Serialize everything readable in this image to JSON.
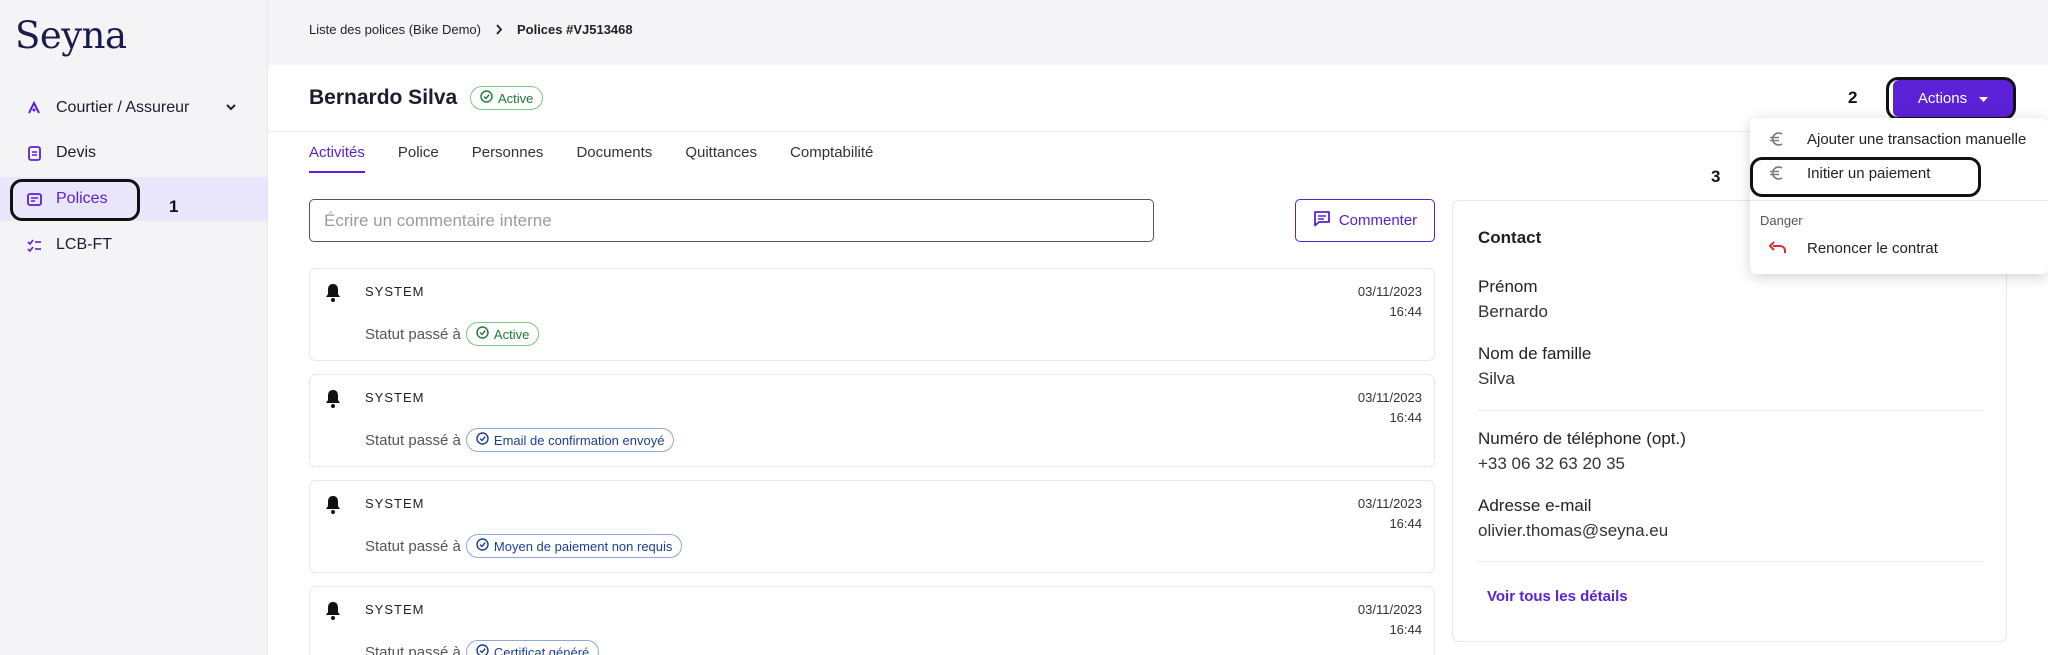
{
  "sidebar": {
    "logo": "Seyna",
    "items": [
      {
        "label": "Courtier / Assureur"
      },
      {
        "label": "Devis"
      },
      {
        "label": "Polices"
      },
      {
        "label": "LCB-FT"
      }
    ]
  },
  "breadcrumb": {
    "parent": "Liste des polices (Bike Demo)",
    "current": "Polices #VJ513468"
  },
  "header": {
    "title": "Bernardo Silva",
    "status": "Active",
    "actions_label": "Actions"
  },
  "tabs": [
    "Activités",
    "Police",
    "Personnes",
    "Documents",
    "Quittances",
    "Comptabilité"
  ],
  "comment": {
    "placeholder": "Écrire un commentaire interne",
    "button_label": "Commenter"
  },
  "activities": [
    {
      "author": "SYSTEM",
      "date": "03/11/2023",
      "time": "16:44",
      "prefix": "Statut passé à",
      "status": "Active"
    },
    {
      "author": "SYSTEM",
      "date": "03/11/2023",
      "time": "16:44",
      "prefix": "Statut passé à",
      "status": "Email de confirmation envoyé"
    },
    {
      "author": "SYSTEM",
      "date": "03/11/2023",
      "time": "16:44",
      "prefix": "Statut passé à",
      "status": "Moyen de paiement non requis"
    },
    {
      "author": "SYSTEM",
      "date": "03/11/2023",
      "time": "16:44",
      "prefix": "Statut passé à",
      "status": "Certificat généré"
    }
  ],
  "contact": {
    "title": "Contact",
    "fields": [
      {
        "label": "Prénom",
        "value": "Bernardo"
      },
      {
        "label": "Nom de famille",
        "value": "Silva"
      },
      {
        "label": "Numéro de téléphone (opt.)",
        "value": "+33 06 32 63 20 35"
      },
      {
        "label": "Adresse e-mail",
        "value": "olivier.thomas@seyna.eu"
      }
    ],
    "see_all": "Voir tous les détails"
  },
  "dropdown": {
    "items": [
      {
        "label": "Ajouter une transaction manuelle",
        "icon": "euro-icon"
      },
      {
        "label": "Initier un paiement",
        "icon": "euro-icon"
      }
    ],
    "section": "Danger",
    "danger_item": {
      "label": "Renoncer le contrat",
      "icon": "undo-icon"
    }
  },
  "annotations": [
    "1",
    "2",
    "3"
  ],
  "colors": {
    "accent": "#5b21d6",
    "active_green": "#1e7a35",
    "status_blue": "#1c3f96",
    "danger_red": "#d32f2f"
  }
}
